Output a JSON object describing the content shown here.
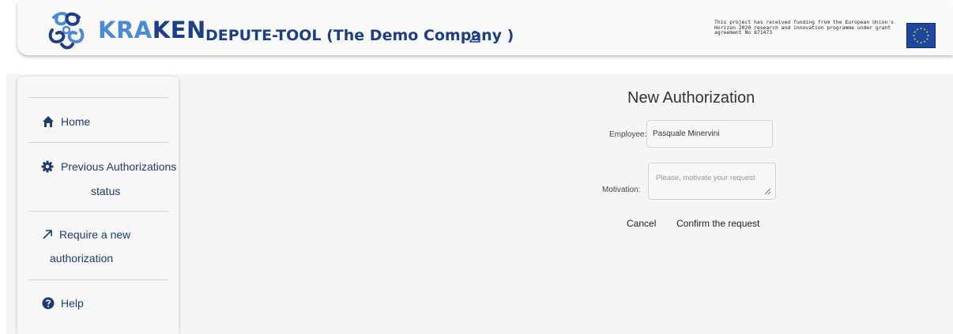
{
  "header": {
    "brand_prefix": "KRA",
    "brand_suffix": "KEN",
    "app_title": "DEPUTE-TOOL (The Demo Company )",
    "user_icon": "user-icon",
    "funding_text": "This project has received funding from the European Union's Horizon 2020 research and innovation programme under grant agreement No 871473",
    "flag_icon": "eu-flag-icon"
  },
  "sidebar": {
    "items": [
      {
        "label": "Home",
        "icon": "home-icon"
      },
      {
        "label_line1": "Previous Authorizations",
        "label_line2": "status",
        "icon": "gear-icon"
      },
      {
        "label_line1": "Require a new",
        "label_line2": "authorization",
        "icon": "arrow-up-right-icon"
      },
      {
        "label": "Help",
        "icon": "help-circle-icon"
      }
    ]
  },
  "form": {
    "title": "New Authorization",
    "employee_label": "Employee:",
    "employee_value": "Pasquale Minervini",
    "motivation_label": "Motivation:",
    "motivation_placeholder": "Please, motivate your request",
    "cancel_label": "Cancel",
    "confirm_label": "Confirm the request"
  },
  "colors": {
    "brand_dark": "#1d3f8a",
    "brand_light": "#4b8ad7",
    "nav_text": "#1d3c6e",
    "eu_blue": "#1d47a0",
    "eu_star": "#ffd400"
  }
}
